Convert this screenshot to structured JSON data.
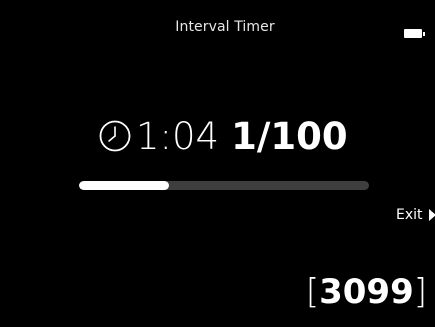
{
  "app": {
    "title": "Interval Timer"
  },
  "status": {
    "battery_level": 1.0
  },
  "timer": {
    "elapsed": "1:04",
    "count": "1/100",
    "progress": 0.31
  },
  "actions": {
    "exit_label": "Exit"
  },
  "footer": {
    "bracket_open": "[",
    "code": "3099",
    "bracket_close": "]"
  },
  "icons": {
    "clock": "clock-icon",
    "battery": "battery-icon",
    "exit": "play-arrow-icon"
  },
  "colors": {
    "background": "#000000",
    "foreground": "#ffffff",
    "track": "#3e3e3e"
  }
}
